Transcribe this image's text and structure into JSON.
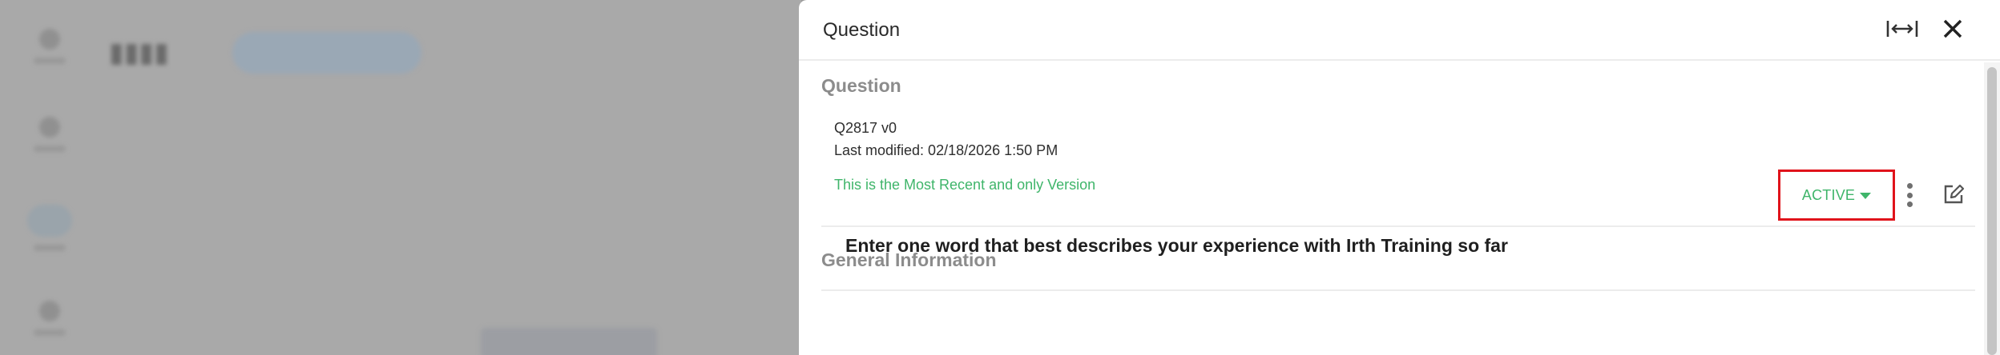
{
  "drawer": {
    "title": "Question",
    "expand_icon": "expand-horizontal-icon",
    "close_icon": "close-icon"
  },
  "question_section": {
    "heading": "Question",
    "id_version": "Q2817  v0",
    "last_modified": "Last modified: 02/18/2026 1:50 PM",
    "version_note": "This is the Most Recent and only Version"
  },
  "general_info": {
    "heading": "General Information",
    "status": "ACTIVE",
    "more_icon": "kebab-menu-icon",
    "edit_icon": "edit-icon",
    "question_text": "Enter one word that best describes your experience with Irth Training so far"
  },
  "colors": {
    "status_green": "#3fb56a",
    "highlight_red": "#e0131b",
    "overlay_gray": "#a9a9a9"
  }
}
